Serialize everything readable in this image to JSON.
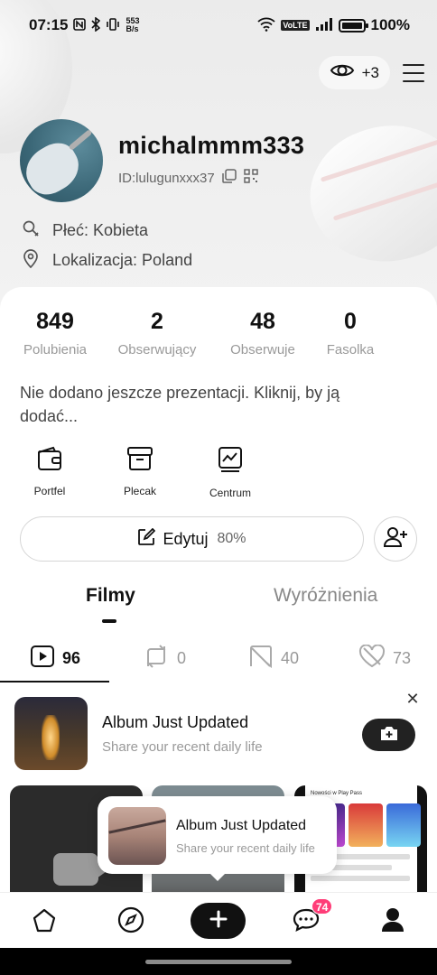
{
  "status_bar": {
    "time": "07:15",
    "net_speed_value": "553",
    "net_speed_unit": "B/s",
    "volte": "VoLTE",
    "battery_percent": "100%",
    "battery_level": 1.0
  },
  "header": {
    "viewers_count": "+3"
  },
  "profile": {
    "username": "michalmmm333",
    "user_id": "ID:lulugunxxx37",
    "gender": "Płeć: Kobieta",
    "location": "Lokalizacja: Poland"
  },
  "stats": [
    {
      "value": "849",
      "label": "Polubienia"
    },
    {
      "value": "2",
      "label": "Obserwujący"
    },
    {
      "value": "48",
      "label": "Obserwuje"
    },
    {
      "value": "0",
      "label": "Fasolka"
    }
  ],
  "bio": "Nie dodano jeszcze prezentacji. Kliknij, by ją dodać...",
  "quick_links": [
    {
      "label": "Portfel",
      "icon": "wallet-icon"
    },
    {
      "label": "Plecak",
      "icon": "backpack-icon"
    },
    {
      "label": "Centrum",
      "icon": "creator-center-icon"
    }
  ],
  "edit": {
    "label": "Edytuj",
    "progress_text": "80%",
    "progress": 0.8
  },
  "tabs": [
    {
      "label": "Filmy",
      "active": true
    },
    {
      "label": "Wyróżnienia",
      "active": false
    }
  ],
  "subtabs": [
    {
      "icon": "video-icon",
      "count": "96",
      "active": true
    },
    {
      "icon": "repost-icon",
      "count": "0",
      "active": false
    },
    {
      "icon": "private-icon",
      "count": "40",
      "active": false
    },
    {
      "icon": "liked-icon",
      "count": "73",
      "active": false
    }
  ],
  "album_banner": {
    "title": "Album Just Updated",
    "subtitle": "Share your recent daily life"
  },
  "popup": {
    "title": "Album Just Updated",
    "subtitle": "Share your recent daily life"
  },
  "grid_thumb": {
    "play_store_title": "Nowości w Play Pass"
  },
  "nav": {
    "items": [
      "home-icon",
      "explore-icon",
      "create-icon",
      "messages-icon",
      "profile-icon"
    ],
    "messages_badge": "74"
  },
  "colors": {
    "accent_badge": "#ff3d78",
    "primary_dark": "#111111",
    "muted_text": "#999999"
  }
}
